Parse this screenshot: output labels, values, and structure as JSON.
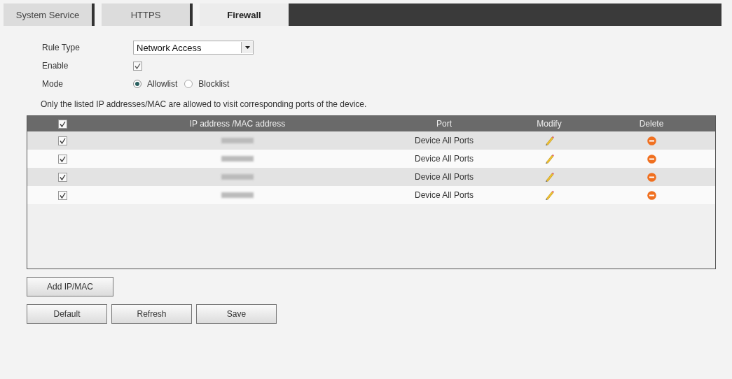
{
  "tabs": [
    {
      "label": "System Service",
      "selected": false
    },
    {
      "label": "HTTPS",
      "selected": false
    },
    {
      "label": "Firewall",
      "selected": true
    }
  ],
  "form": {
    "rule_type": {
      "label": "Rule Type",
      "value": "Network Access"
    },
    "enable": {
      "label": "Enable",
      "checked": true
    },
    "mode": {
      "label": "Mode",
      "options": [
        {
          "label": "Allowlist",
          "selected": true
        },
        {
          "label": "Blocklist",
          "selected": false
        }
      ]
    },
    "note": "Only the listed IP addresses/MAC are allowed to visit corresponding ports of the device."
  },
  "table": {
    "select_all_checked": true,
    "columns": [
      "IP address /MAC address",
      "Port",
      "Modify",
      "Delete"
    ],
    "rows": [
      {
        "checked": true,
        "port": "Device All Ports"
      },
      {
        "checked": true,
        "port": "Device All Ports"
      },
      {
        "checked": true,
        "port": "Device All Ports"
      },
      {
        "checked": true,
        "port": "Device All Ports"
      }
    ]
  },
  "add_button": "Add IP/MAC",
  "buttons": [
    "Default",
    "Refresh",
    "Save"
  ]
}
